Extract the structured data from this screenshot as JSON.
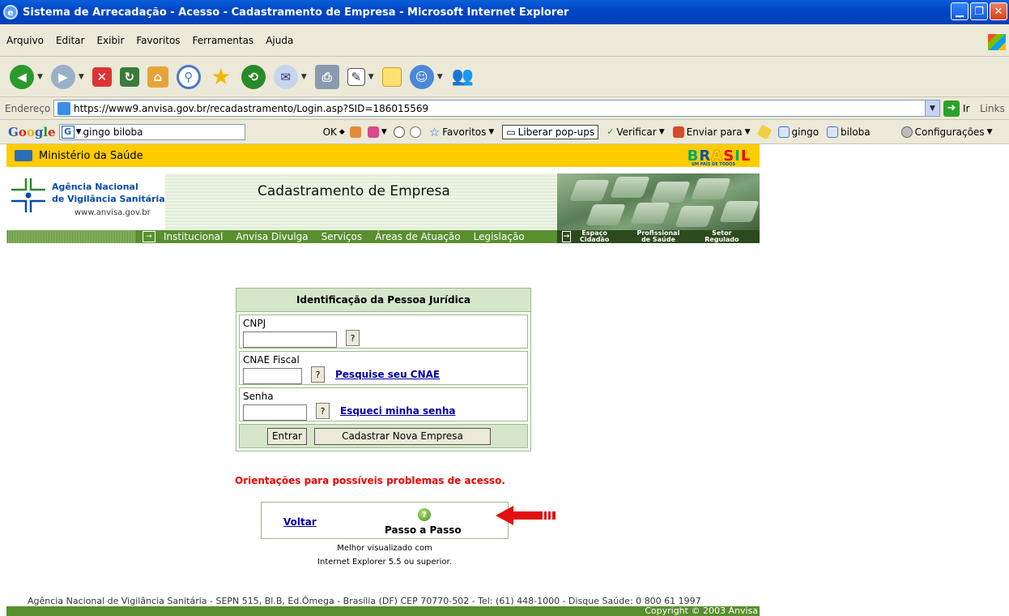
{
  "window": {
    "title": "Sistema de Arrecadação - Acesso - Cadastramento de Empresa - Microsoft Internet Explorer"
  },
  "menu": [
    "Arquivo",
    "Editar",
    "Exibir",
    "Favoritos",
    "Ferramentas",
    "Ajuda"
  ],
  "address": {
    "label": "Endereço",
    "url": "https://www9.anvisa.gov.br/recadastramento/Login.asp?SID=186015569",
    "go": "Ir",
    "links": "Links"
  },
  "googlebar": {
    "logo": "Google",
    "query": "gingo biloba",
    "ok": "OK",
    "favoritos": "Favoritos",
    "popups": "Liberar pop-ups",
    "verificar": "Verificar",
    "enviar": "Enviar para",
    "term1": "gingo",
    "term2": "biloba",
    "config": "Configurações"
  },
  "site": {
    "ministry": "Ministério da Saúde",
    "brasil": "BRASIL",
    "brasil_sub": "UM PAÍS DE TODOS",
    "agency_line1": "Agência Nacional",
    "agency_line2": "de Vigilância Sanitária",
    "agency_url": "www.anvisa.gov.br",
    "header_title": "Cadastramento de Empresa",
    "nav": [
      "Institucional",
      "Anvisa Divulga",
      "Serviços",
      "Áreas de Atuação",
      "Legislação"
    ],
    "nav_right": [
      "Espaço Cidadão",
      "Profissional de Saúde",
      "Setor Regulado"
    ]
  },
  "form": {
    "title": "Identificação da Pessoa Jurídica",
    "cnpj_label": "CNPJ",
    "cnae_label": "CNAE Fiscal",
    "cnae_link": "Pesquise seu CNAE",
    "senha_label": "Senha",
    "senha_link": "Esqueci minha senha",
    "help_q": "?",
    "entrar": "Entrar",
    "cadastrar": "Cadastrar Nova Empresa"
  },
  "orientacoes": "Orientações para possíveis problemas de acesso.",
  "help": {
    "voltar": "Voltar",
    "passo": "Passo a Passo"
  },
  "note_line1": "Melhor visualizado com",
  "note_line2": "Internet Explorer 5.5 ou superior.",
  "footer": "Agência Nacional de Vigilância Sanitária - SEPN 515, Bl.B, Ed.Ômega - Brasília (DF) CEP 70770-502 - Tel: (61) 448-1000 - Disque Saúde: 0 800 61 1997",
  "copyright": "Copyright © 2003 Anvisa",
  "colors": {
    "ministry_bar": "#ffcc00",
    "nav_green": "#598f2f",
    "form_header": "#d5e6cb",
    "alert_red": "#ee0000",
    "link_blue": "#0000aa"
  }
}
